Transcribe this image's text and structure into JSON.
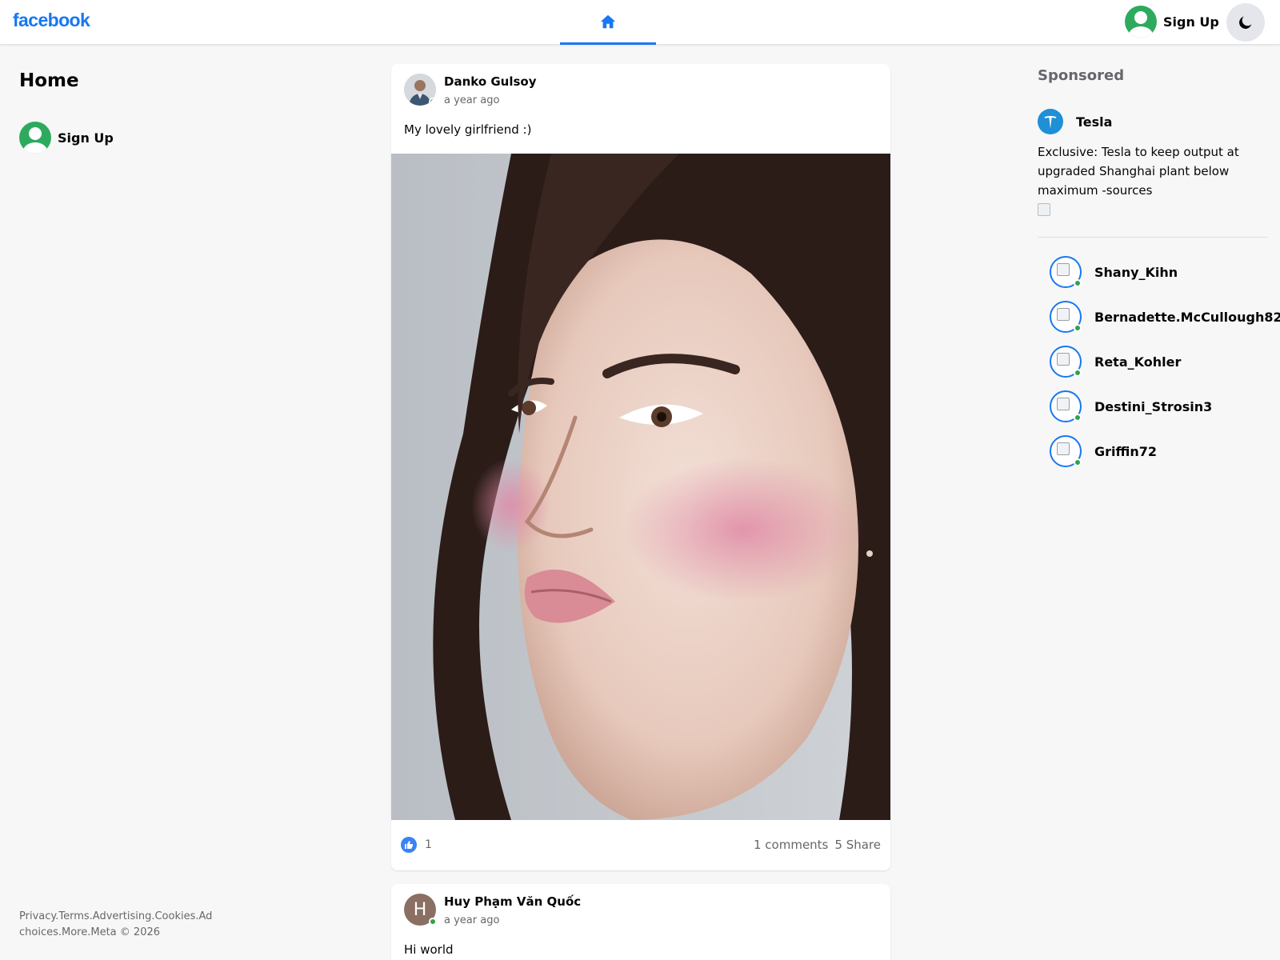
{
  "header": {
    "logo": "facebook",
    "signup_label": "Sign Up"
  },
  "left": {
    "title": "Home",
    "signup_label": "Sign Up",
    "footer_links": [
      "Privacy.",
      "Terms.",
      "Advertising.",
      "Cookies.",
      "Ad choices.",
      "More.",
      "Meta © 2026"
    ]
  },
  "posts": [
    {
      "author": "Danko Gulsoy",
      "time": "a year ago",
      "text": "My lovely girlfriend :)",
      "likes": "1",
      "comments": "1 comments",
      "shares": "5 Share"
    },
    {
      "author": "Huy Phạm Văn Quốc",
      "avatar_letter": "H",
      "time": "a year ago",
      "text": "Hi world"
    }
  ],
  "sponsored": {
    "title": "Sponsored",
    "ad": {
      "brand": "Tesla",
      "text": "Exclusive: Tesla to keep output at upgraded Shanghai plant below maximum -sources"
    }
  },
  "contacts": [
    {
      "name": "Shany_Kihn"
    },
    {
      "name": "Bernadette.McCullough82"
    },
    {
      "name": "Reta_Kohler"
    },
    {
      "name": "Destini_Strosin3"
    },
    {
      "name": "Griffin72"
    }
  ],
  "colors": {
    "brand": "#1877f2",
    "online": "#31a24c",
    "avatar_green": "#2eaa5f",
    "background": "#f7f7f7"
  },
  "icons": {
    "home": "home-icon",
    "theme": "moon-icon",
    "like": "thumbs-up-icon",
    "ad": "tesla-logo-icon"
  }
}
